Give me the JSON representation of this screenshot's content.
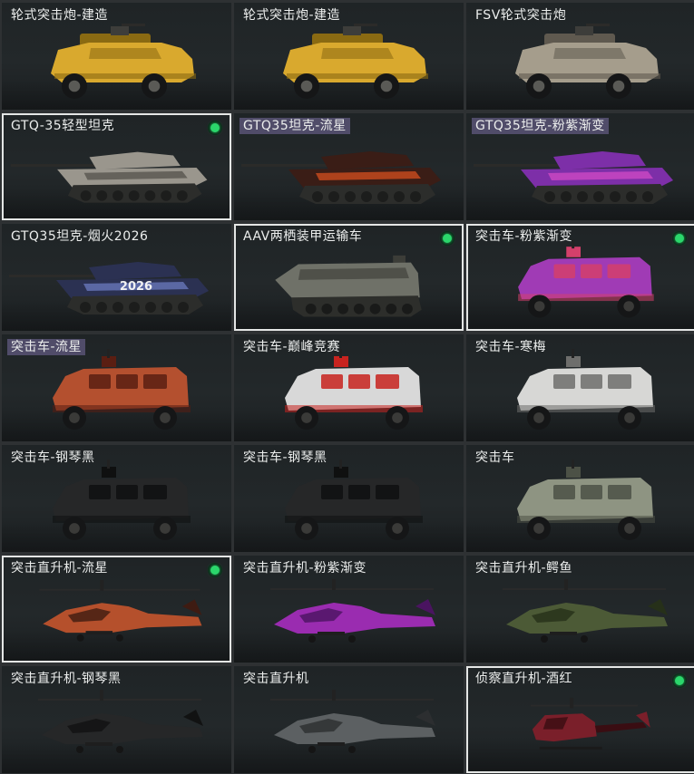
{
  "gallery": {
    "items": [
      {
        "name": "轮式突击炮-建造",
        "kind": "wheeled",
        "body": "#d9a92e",
        "dark": "#8a6a12",
        "selected": false,
        "equipped": false,
        "tagged": false
      },
      {
        "name": "轮式突击炮-建造",
        "kind": "wheeled",
        "body": "#d9a92e",
        "dark": "#8a6a12",
        "selected": false,
        "equipped": false,
        "tagged": false
      },
      {
        "name": "FSV轮式突击炮",
        "kind": "wheeled",
        "body": "#a59d8c",
        "dark": "#5f594f",
        "selected": false,
        "equipped": false,
        "tagged": false
      },
      {
        "name": "GTQ-35轻型坦克",
        "kind": "tank",
        "body": "#9a968d",
        "dark": "#4f4c46",
        "selected": true,
        "equipped": true,
        "tagged": false
      },
      {
        "name": "GTQ35坦克-流星",
        "kind": "tank",
        "body": "#3a1d16",
        "dark": "#e0521f",
        "selected": false,
        "equipped": false,
        "tagged": true
      },
      {
        "name": "GTQ35坦克-粉紫渐变",
        "kind": "tank",
        "body": "#7d2fa8",
        "dark": "#d84bc8",
        "selected": false,
        "equipped": false,
        "tagged": true
      },
      {
        "name": "GTQ35坦克-烟火2026",
        "kind": "tank",
        "body": "#2b3152",
        "dark": "#7180c8",
        "selected": false,
        "equipped": false,
        "tagged": false,
        "hull_text": "2026"
      },
      {
        "name": "AAV两栖装甲运输车",
        "kind": "apc",
        "body": "#6f7168",
        "dark": "#3a3b36",
        "selected": true,
        "equipped": true,
        "tagged": false
      },
      {
        "name": "突击车-粉紫渐变",
        "kind": "truck",
        "body": "#a03bb5",
        "dark": "#d4406b",
        "selected": true,
        "equipped": true,
        "tagged": false
      },
      {
        "name": "突击车-流星",
        "kind": "truck",
        "body": "#b4502f",
        "dark": "#5a1e12",
        "selected": false,
        "equipped": false,
        "tagged": true
      },
      {
        "name": "突击车-巅峰竞赛",
        "kind": "truck",
        "body": "#d8d8d8",
        "dark": "#c8231f",
        "selected": false,
        "equipped": false,
        "tagged": false
      },
      {
        "name": "突击车-寒梅",
        "kind": "truck",
        "body": "#d7d7d5",
        "dark": "#6e6e6c",
        "selected": false,
        "equipped": false,
        "tagged": false
      },
      {
        "name": "突击车-钢琴黑",
        "kind": "truck",
        "body": "#262728",
        "dark": "#0f1010",
        "selected": false,
        "equipped": false,
        "tagged": false
      },
      {
        "name": "突击车-钢琴黑",
        "kind": "truck",
        "body": "#262728",
        "dark": "#0f1010",
        "selected": false,
        "equipped": false,
        "tagged": false
      },
      {
        "name": "突击车",
        "kind": "truck",
        "body": "#8e9482",
        "dark": "#4c5146",
        "selected": false,
        "equipped": false,
        "tagged": false
      },
      {
        "name": "突击直升机-流星",
        "kind": "heli",
        "body": "#b5502c",
        "dark": "#3e1b12",
        "selected": true,
        "equipped": true,
        "tagged": false
      },
      {
        "name": "突击直升机-粉紫渐变",
        "kind": "heli",
        "body": "#9a2cb0",
        "dark": "#4a1460",
        "selected": false,
        "equipped": false,
        "tagged": false
      },
      {
        "name": "突击直升机-鳄鱼",
        "kind": "heli",
        "body": "#4c5a36",
        "dark": "#263019",
        "selected": false,
        "equipped": false,
        "tagged": false
      },
      {
        "name": "突击直升机-钢琴黑",
        "kind": "heli",
        "body": "#262728",
        "dark": "#111212",
        "selected": false,
        "equipped": false,
        "tagged": false
      },
      {
        "name": "突击直升机",
        "kind": "heli",
        "body": "#5c6062",
        "dark": "#2c2e30",
        "selected": false,
        "equipped": false,
        "tagged": false
      },
      {
        "name": "侦察直升机-酒红",
        "kind": "scout",
        "body": "#7a1f2a",
        "dark": "#3a0d12",
        "selected": true,
        "equipped": true,
        "tagged": false
      }
    ]
  }
}
